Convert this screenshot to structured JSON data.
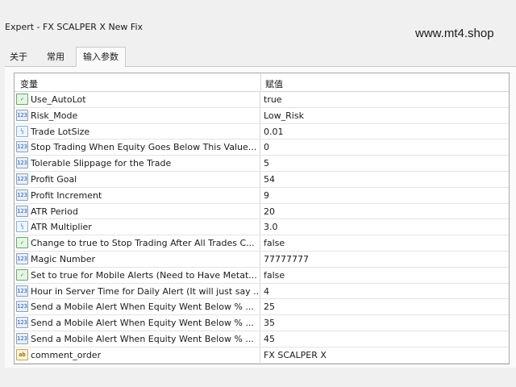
{
  "window": {
    "title": "Expert - FX SCALPER X New Fix"
  },
  "watermark": "www.mt4.shop",
  "tabs": [
    {
      "label": "关于"
    },
    {
      "label": "常用"
    },
    {
      "label": "输入参数"
    }
  ],
  "grid": {
    "headers": {
      "variable": "变量",
      "value": "赋值"
    },
    "rows": [
      {
        "icon": "bool",
        "icon_glyph": "✓",
        "name": "Use_AutoLot",
        "value": "true"
      },
      {
        "icon": "int",
        "icon_glyph": "123",
        "name": "Risk_Mode",
        "value": "Low_Risk"
      },
      {
        "icon": "dbl",
        "icon_glyph": "½",
        "name": "Trade LotSize",
        "value": "0.01"
      },
      {
        "icon": "int",
        "icon_glyph": "123",
        "name": "Stop Trading When Equity Goes Below This Value...",
        "value": "0"
      },
      {
        "icon": "int",
        "icon_glyph": "123",
        "name": "Tolerable Slippage for the Trade",
        "value": "5"
      },
      {
        "icon": "int",
        "icon_glyph": "123",
        "name": "Profit Goal",
        "value": "54"
      },
      {
        "icon": "int",
        "icon_glyph": "123",
        "name": "Profit Increment",
        "value": "9"
      },
      {
        "icon": "int",
        "icon_glyph": "123",
        "name": "ATR Period",
        "value": "20"
      },
      {
        "icon": "dbl",
        "icon_glyph": "½",
        "name": "ATR Multiplier",
        "value": "3.0"
      },
      {
        "icon": "bool",
        "icon_glyph": "✓",
        "name": "Change to true to Stop Trading After All Trades C...",
        "value": "false"
      },
      {
        "icon": "int",
        "icon_glyph": "123",
        "name": "Magic Number",
        "value": "77777777"
      },
      {
        "icon": "bool",
        "icon_glyph": "✓",
        "name": "Set to true for Mobile Alerts (Need to Have Metat...",
        "value": "false"
      },
      {
        "icon": "int",
        "icon_glyph": "123",
        "name": "Hour in Server Time for Daily Alert (It will just say ...",
        "value": "4"
      },
      {
        "icon": "int",
        "icon_glyph": "123",
        "name": "Send a Mobile Alert When Equity Went Below % ...",
        "value": "25"
      },
      {
        "icon": "int",
        "icon_glyph": "123",
        "name": "Send a Mobile Alert When Equity Went Below % ...",
        "value": "35"
      },
      {
        "icon": "int",
        "icon_glyph": "123",
        "name": "Send a Mobile Alert When Equity Went Below % ...",
        "value": "45"
      },
      {
        "icon": "str",
        "icon_glyph": "ab",
        "name": "comment_order",
        "value": "FX SCALPER X"
      }
    ]
  }
}
